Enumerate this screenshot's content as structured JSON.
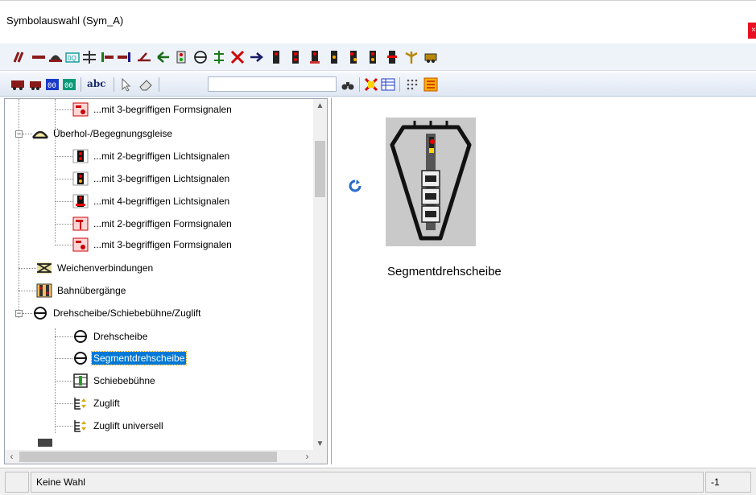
{
  "window": {
    "title": "Symbolauswahl (Sym_A)",
    "close_label": "×"
  },
  "toolbar2": {
    "abc_label": "abc",
    "search_value": ""
  },
  "tree": {
    "items": [
      {
        "label": "...mit 3-begriffigen Formsignalen",
        "icon": "form-signal-3-icon"
      },
      {
        "label": "Überhol-/Begegnungsgleise",
        "icon": "passing-track-icon"
      },
      {
        "label": "...mit 2-begriffigen Lichtsignalen",
        "icon": "light-signal-2-icon"
      },
      {
        "label": "...mit 3-begriffigen Lichtsignalen",
        "icon": "light-signal-3-icon"
      },
      {
        "label": "...mit 4-begriffigen Lichtsignalen",
        "icon": "light-signal-4-icon"
      },
      {
        "label": "...mit 2-begriffigen Formsignalen",
        "icon": "form-signal-2-icon"
      },
      {
        "label": "...mit 3-begriffigen Formsignalen",
        "icon": "form-signal-3-icon"
      },
      {
        "label": "Weichenverbindungen",
        "icon": "switch-connection-icon"
      },
      {
        "label": "Bahnübergänge",
        "icon": "level-crossing-icon"
      },
      {
        "label": "Drehscheibe/Schiebebühne/Zuglift",
        "icon": "turntable-icon"
      },
      {
        "label": "Drehscheibe",
        "icon": "turntable-icon"
      },
      {
        "label": "Segmentdrehscheibe",
        "icon": "turntable-icon"
      },
      {
        "label": "Schiebebühne",
        "icon": "transfer-table-icon"
      },
      {
        "label": "Zuglift",
        "icon": "train-lift-icon"
      },
      {
        "label": "Zuglift universell",
        "icon": "train-lift-icon"
      }
    ]
  },
  "preview": {
    "caption": "Segmentdrehscheibe"
  },
  "status": {
    "text": "Keine Wahl",
    "value": "-1"
  },
  "colors": {
    "accent": "#0078d7",
    "toolbar_bg": "#eef3fa",
    "close": "#e81123"
  }
}
